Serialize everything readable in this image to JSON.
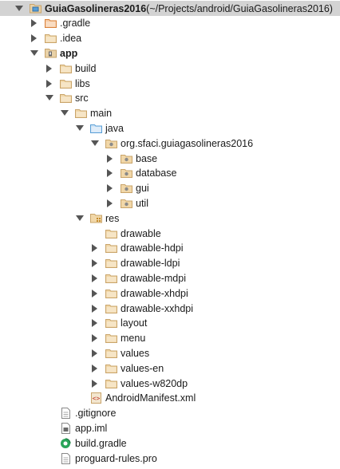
{
  "tree": {
    "rows": [
      {
        "label": "GuiaGasolineras2016",
        "suffix": " (~/Projects/android/GuiaGasolineras2016)",
        "depth": 0,
        "arrow": "expanded",
        "icon": "module-icon",
        "selected": true,
        "bold": true
      },
      {
        "label": ".gradle",
        "depth": 1,
        "arrow": "collapsed",
        "icon": "folder-orange-icon"
      },
      {
        "label": ".idea",
        "depth": 1,
        "arrow": "collapsed",
        "icon": "folder-icon"
      },
      {
        "label": "app",
        "depth": 1,
        "arrow": "expanded",
        "icon": "module-folder-icon",
        "bold": true
      },
      {
        "label": "build",
        "depth": 2,
        "arrow": "collapsed",
        "icon": "folder-icon"
      },
      {
        "label": "libs",
        "depth": 2,
        "arrow": "collapsed",
        "icon": "folder-icon"
      },
      {
        "label": "src",
        "depth": 2,
        "arrow": "expanded",
        "icon": "folder-icon"
      },
      {
        "label": "main",
        "depth": 3,
        "arrow": "expanded",
        "icon": "folder-icon"
      },
      {
        "label": "java",
        "depth": 4,
        "arrow": "expanded",
        "icon": "source-folder-icon"
      },
      {
        "label": "org.sfaci.guiagasolineras2016",
        "depth": 5,
        "arrow": "expanded",
        "icon": "package-icon"
      },
      {
        "label": "base",
        "depth": 6,
        "arrow": "collapsed",
        "icon": "package-icon"
      },
      {
        "label": "database",
        "depth": 6,
        "arrow": "collapsed",
        "icon": "package-icon"
      },
      {
        "label": "gui",
        "depth": 6,
        "arrow": "collapsed",
        "icon": "package-icon"
      },
      {
        "label": "util",
        "depth": 6,
        "arrow": "collapsed",
        "icon": "package-icon"
      },
      {
        "label": "res",
        "depth": 4,
        "arrow": "expanded",
        "icon": "resource-folder-icon"
      },
      {
        "label": "drawable",
        "depth": 5,
        "arrow": "none",
        "icon": "folder-icon"
      },
      {
        "label": "drawable-hdpi",
        "depth": 5,
        "arrow": "collapsed",
        "icon": "folder-icon"
      },
      {
        "label": "drawable-ldpi",
        "depth": 5,
        "arrow": "collapsed",
        "icon": "folder-icon"
      },
      {
        "label": "drawable-mdpi",
        "depth": 5,
        "arrow": "collapsed",
        "icon": "folder-icon"
      },
      {
        "label": "drawable-xhdpi",
        "depth": 5,
        "arrow": "collapsed",
        "icon": "folder-icon"
      },
      {
        "label": "drawable-xxhdpi",
        "depth": 5,
        "arrow": "collapsed",
        "icon": "folder-icon"
      },
      {
        "label": "layout",
        "depth": 5,
        "arrow": "collapsed",
        "icon": "folder-icon"
      },
      {
        "label": "menu",
        "depth": 5,
        "arrow": "collapsed",
        "icon": "folder-icon"
      },
      {
        "label": "values",
        "depth": 5,
        "arrow": "collapsed",
        "icon": "folder-icon"
      },
      {
        "label": "values-en",
        "depth": 5,
        "arrow": "collapsed",
        "icon": "folder-icon"
      },
      {
        "label": "values-w820dp",
        "depth": 5,
        "arrow": "collapsed",
        "icon": "folder-icon"
      },
      {
        "label": "AndroidManifest.xml",
        "depth": 4,
        "arrow": "none",
        "icon": "xml-file-icon"
      },
      {
        "label": ".gitignore",
        "depth": 2,
        "arrow": "none",
        "icon": "text-file-icon"
      },
      {
        "label": "app.iml",
        "depth": 2,
        "arrow": "none",
        "icon": "iml-file-icon"
      },
      {
        "label": "build.gradle",
        "depth": 2,
        "arrow": "none",
        "icon": "gradle-file-icon"
      },
      {
        "label": "proguard-rules.pro",
        "depth": 2,
        "arrow": "none",
        "icon": "text-file-icon"
      }
    ]
  },
  "colors": {
    "folder": "#c9a46a",
    "folder_orange": "#d9823b",
    "source_folder": "#5a9fd6",
    "package_dot": "#8a8a8a",
    "selection": "#d3d3d3",
    "arrow": "#555555",
    "gradle": "#2aa55a"
  }
}
